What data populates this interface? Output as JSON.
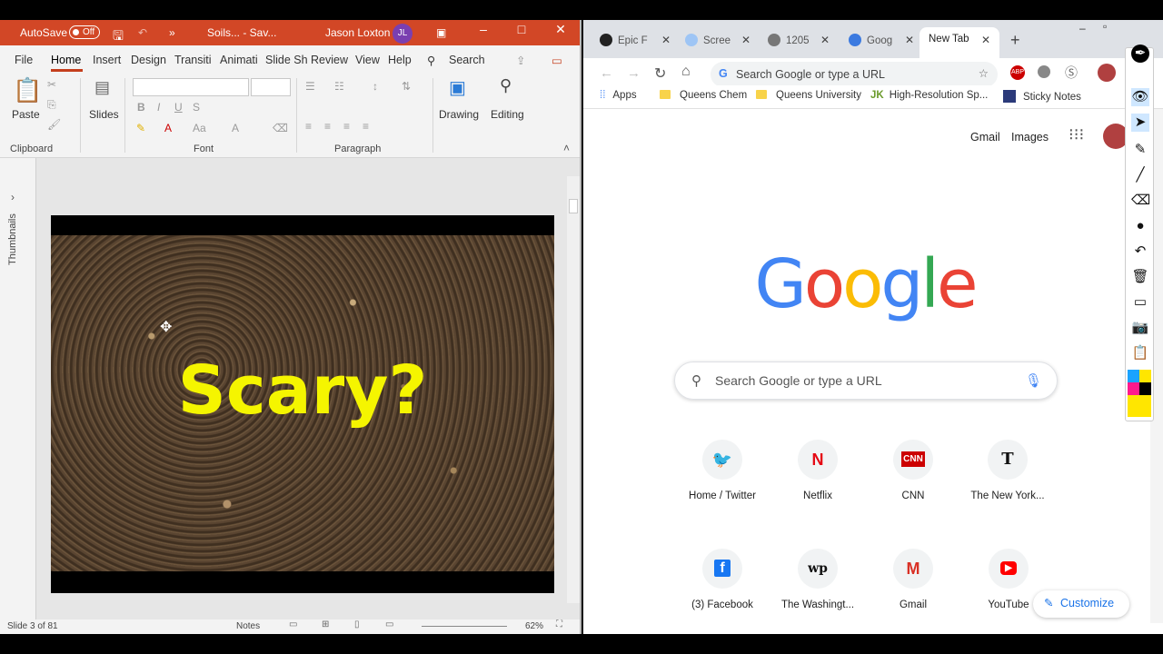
{
  "ppt": {
    "title_bar": {
      "autosave": "AutoSave",
      "toggle": "Off",
      "doc_title": "Soils... - Sav...",
      "user": "Jason Loxton",
      "initials": "JL"
    },
    "tabs": [
      "File",
      "Home",
      "Insert",
      "Design",
      "Transiti",
      "Animati",
      "Slide Sh",
      "Review",
      "View",
      "Help"
    ],
    "search": "Search",
    "ribbon": {
      "paste": "Paste",
      "slides": "Slides",
      "drawing": "Drawing",
      "editing": "Editing",
      "groups": {
        "clipboard": "Clipboard",
        "font": "Font",
        "paragraph": "Paragraph"
      }
    },
    "thumbnails": "Thumbnails",
    "slide_text": "Scary?",
    "status": {
      "slide": "Slide 3 of 81",
      "notes": "Notes",
      "zoom": "62%"
    }
  },
  "chrome": {
    "tabs": [
      {
        "label": "Epic F",
        "fav_color": "#222"
      },
      {
        "label": "Scree",
        "fav_color": "#4a90e2"
      },
      {
        "label": "1205",
        "fav_color": "#555"
      },
      {
        "label": "Goog",
        "fav_color": "#3b7ae0"
      },
      {
        "label": "New Tab",
        "fav_color": "#fff"
      }
    ],
    "omnibox_placeholder": "Search Google or type a URL",
    "bookmarks": [
      "Apps",
      "Queens Chem",
      "Queens University",
      "High-Resolution Sp...",
      "Sticky Notes"
    ],
    "header_links": {
      "gmail": "Gmail",
      "images": "Images"
    },
    "logo_letters": [
      {
        "ch": "G",
        "color": "#4285f4"
      },
      {
        "ch": "o",
        "color": "#ea4335"
      },
      {
        "ch": "o",
        "color": "#fbbc05"
      },
      {
        "ch": "g",
        "color": "#4285f4"
      },
      {
        "ch": "l",
        "color": "#34a853"
      },
      {
        "ch": "e",
        "color": "#ea4335"
      }
    ],
    "search_placeholder": "Search Google or type a URL",
    "shortcuts": [
      {
        "label": "Home / Twitter",
        "icon": "twitter-icon",
        "glyph": "🐦",
        "color": "#1da1f2"
      },
      {
        "label": "Netflix",
        "icon": "netflix-icon",
        "glyph": "N",
        "color": "#e50914"
      },
      {
        "label": "CNN",
        "icon": "cnn-icon",
        "glyph": "CNN",
        "color": "#cc0000"
      },
      {
        "label": "The New York...",
        "icon": "nyt-icon",
        "glyph": "𝕿",
        "color": "#111"
      },
      {
        "label": "(3) Facebook",
        "icon": "facebook-icon",
        "glyph": "f",
        "color": "#1877f2"
      },
      {
        "label": "The Washingt...",
        "icon": "wapo-icon",
        "glyph": "wp",
        "color": "#111"
      },
      {
        "label": "Gmail",
        "icon": "gmail-icon",
        "glyph": "M",
        "color": "#d93025"
      },
      {
        "label": "YouTube",
        "icon": "youtube-icon",
        "glyph": "▶",
        "color": "#ff0000"
      }
    ],
    "customize": "Customize"
  }
}
